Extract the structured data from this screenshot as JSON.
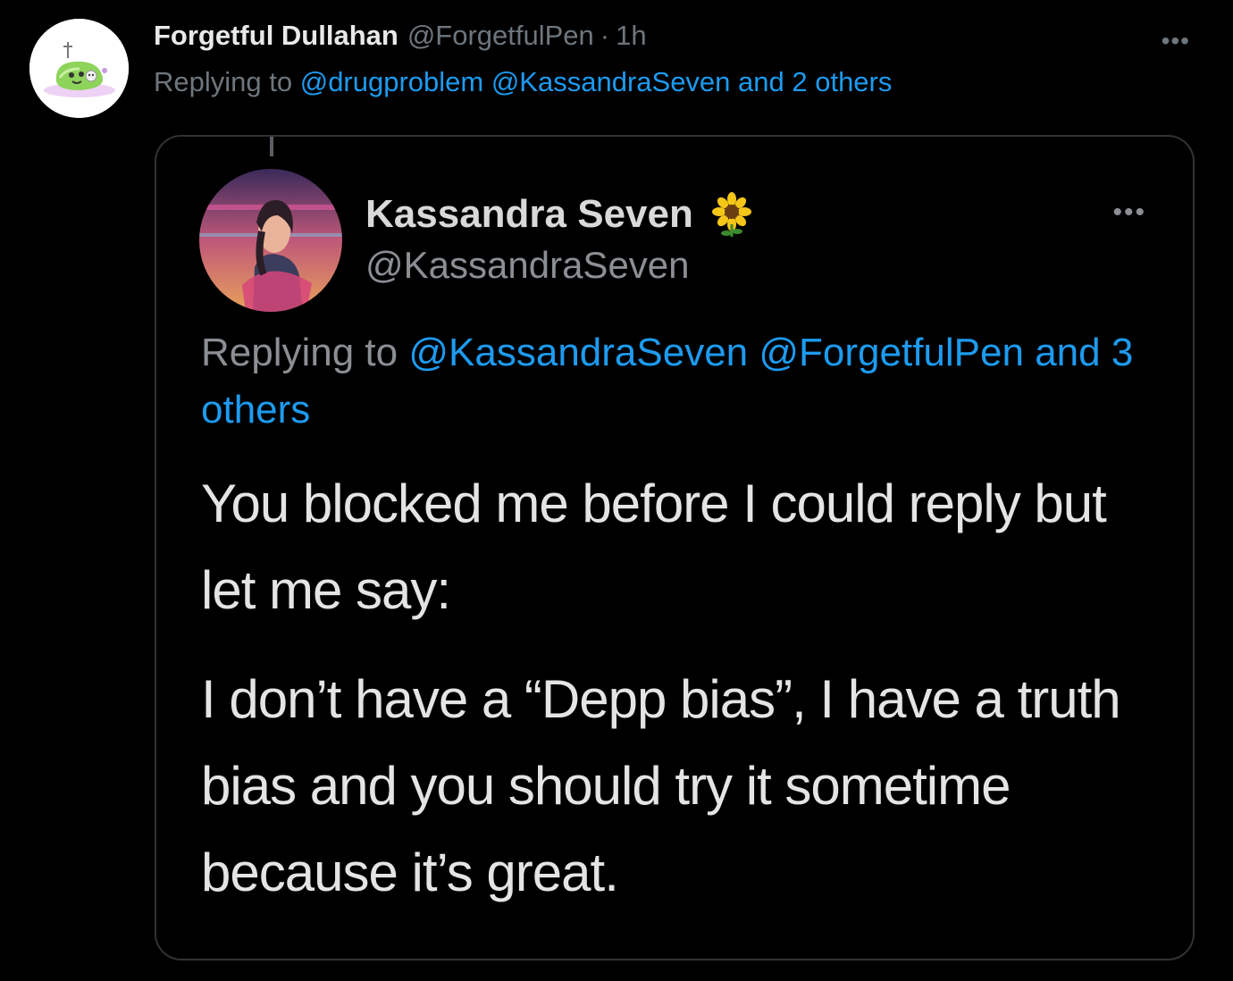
{
  "tweet": {
    "author": {
      "display_name": "Forgetful Dullahan",
      "handle": "@ForgetfulPen",
      "separator": "·",
      "time": "1h"
    },
    "replying_prefix": "Replying to",
    "replying_mentions": "@drugproblem @KassandraSeven and 2 others",
    "more_label": "•••"
  },
  "screenshot": {
    "author": {
      "display_name": "Kassandra Seven",
      "handle": "@KassandraSeven"
    },
    "more_label": "•••",
    "replying_prefix": "Replying to",
    "replying_mentions": "@KassandraSeven @ForgetfulPen and 3 others",
    "body_paragraph_1": "You blocked me before I could reply but let me say:",
    "body_paragraph_2": "I don’t have a “Depp bias”, I have a truth bias and you should try it sometime because it’s great."
  },
  "colors": {
    "background": "#000000",
    "link": "#1d9bf0",
    "secondary_text": "#6e767d",
    "primary_text": "#e7e9ea",
    "card_border": "#2f3336"
  },
  "icons": {
    "top_avatar": "slime-potion-avatar",
    "screenshot_avatar": "warrior-woman-avatar",
    "emoji": "sunflower-icon",
    "more": "more-horizontal-icon"
  }
}
